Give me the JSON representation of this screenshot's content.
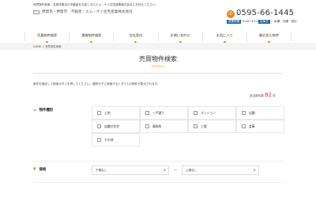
{
  "header": {
    "tagline": "売買物件検索｜名張市周辺の不動産をお探しならエム・ケイ住宅産業株式会社にお任せください。",
    "logo_text": "伊賀市・伊賀市　不動産｜エム・ケイ住宅産業株式会社",
    "tel_icon": "phone-icon",
    "tel": "0595-66-1445",
    "hours_label": "営業時間",
    "hours": "9:00～17:00",
    "holiday_label": "定休日",
    "holiday": "水曜・日曜・祝日"
  },
  "nav": {
    "items": [
      "売買物件検索",
      "賃貸物件検索",
      "会社案内",
      "お問い合わせ",
      "お気に入り",
      "最近見た物件"
    ]
  },
  "breadcrumb": {
    "home": "HOME",
    "separator": ">",
    "current": "売買物件検索"
  },
  "page": {
    "title": "売買物件検索",
    "subtitle": "SEARCH",
    "description": "条件を指定して検索ボタンを押してください。選択せずに検索するとすべての物件が表示されます。",
    "count_label": "該当物件数",
    "count_value": "82",
    "count_unit": "件"
  },
  "property_type": {
    "label": "物件種別",
    "icon": "house-icon",
    "options": [
      "土地",
      "一戸建て",
      "マンション",
      "店舗",
      "店舗付住宅",
      "事務所",
      "工場",
      "倉庫",
      "その他"
    ]
  },
  "price": {
    "label": "価格",
    "icon": "yen-icon",
    "min": "下限なし",
    "max": "上限なし",
    "tilde": "～"
  },
  "accent_color": "#e08a1e"
}
